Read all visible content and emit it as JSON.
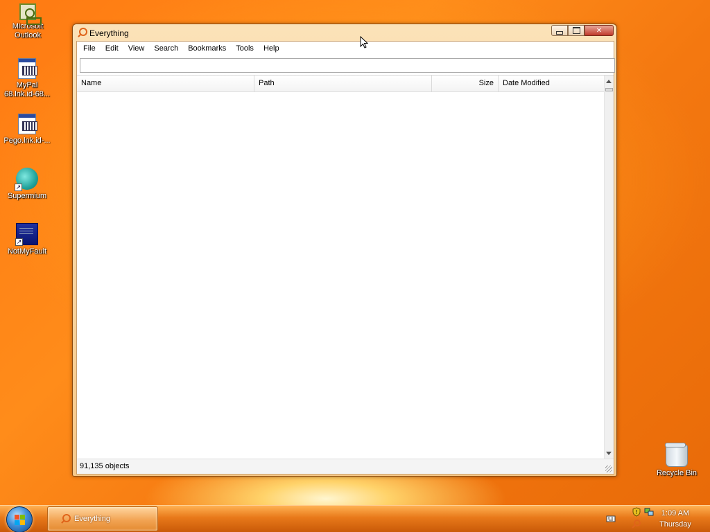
{
  "desktop": {
    "icons": [
      {
        "label": "Microsoft Outlook"
      },
      {
        "label": "MyPal 68.lnk.id-68..."
      },
      {
        "label": "Pego.lnk.id-..."
      },
      {
        "label": "Supermium"
      },
      {
        "label": "NotMyFault"
      },
      {
        "label": "Recycle Bin"
      }
    ]
  },
  "window": {
    "title": "Everything",
    "menu": [
      "File",
      "Edit",
      "View",
      "Search",
      "Bookmarks",
      "Tools",
      "Help"
    ],
    "search": {
      "value": "",
      "placeholder": ""
    },
    "columns": {
      "name": "Name",
      "path": "Path",
      "size": "Size",
      "date_modified": "Date Modified"
    },
    "rows": [],
    "status": "91,135 objects"
  },
  "taskbar": {
    "tasks": [
      {
        "label": "Everything"
      }
    ],
    "clock": {
      "time": "1:09 AM",
      "day": "Thursday"
    }
  },
  "colors": {
    "accent": "#e8791a",
    "window_frame": "#f7c98a",
    "desktop": "#ff7a12"
  }
}
